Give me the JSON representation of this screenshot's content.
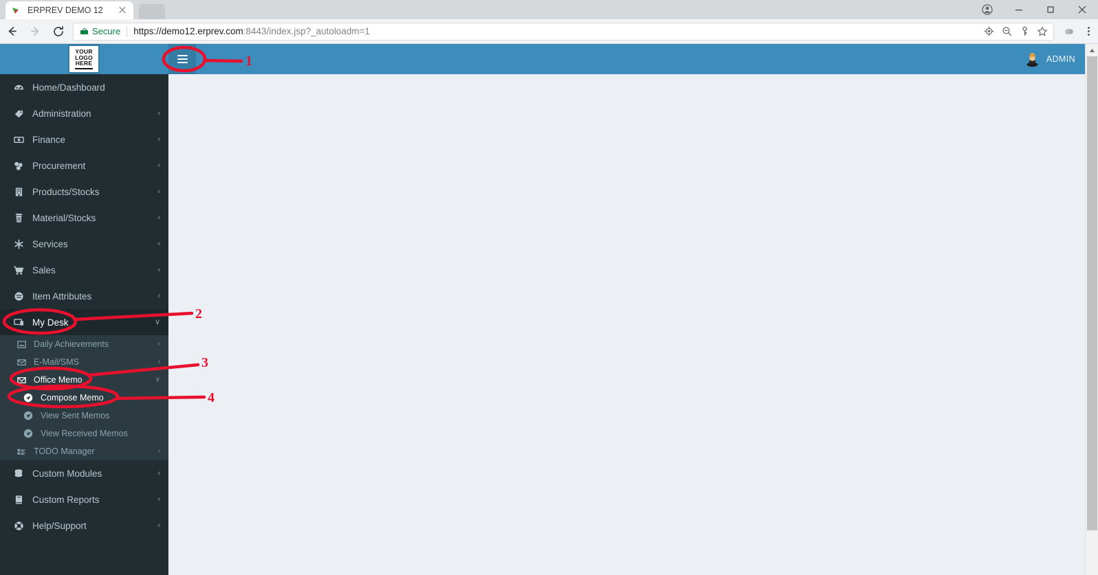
{
  "browser": {
    "tab": {
      "title": "ERPREV DEMO 12",
      "favicon": "erprev-favicon",
      "close": "close-tab-icon"
    },
    "new_tab_ghost": "inactive-tab",
    "nav": {
      "back": "back-arrow-icon",
      "forward": "forward-arrow-icon",
      "reload": "reload-icon"
    },
    "omnibox": {
      "security_label": "Secure",
      "url_scheme_host": "https://demo12.erprev.com",
      "url_rest": ":8443/index.jsp?_autoloadm=1",
      "full_url": "https://demo12.erprev.com:8443/index.jsp?_autoloadm=1",
      "icons": [
        "location-target-icon",
        "zoom-out-icon",
        "key-icon",
        "bookmark-star-icon"
      ]
    },
    "toolbar_icons": [
      "extension-icon",
      "chrome-menu-icon"
    ],
    "window_controls": [
      "profile-icon",
      "minimize-icon",
      "maximize-icon",
      "close-icon"
    ]
  },
  "topbar": {
    "logo_line1": "YOUR",
    "logo_line2": "LOGO",
    "logo_line3": "HERE",
    "toggle": "hamburger-menu-icon",
    "user_name": "ADMIN",
    "avatar": "user-avatar-icon",
    "accent_color": "#3c8dbc",
    "accent_dark_color": "#357ca5"
  },
  "sidebar": {
    "background_color": "#222d32",
    "submenu_background_color": "#2c3b41",
    "items": [
      {
        "label": "Home/Dashboard",
        "icon": "dashboard-icon",
        "arrow": ""
      },
      {
        "label": "Administration",
        "icon": "tags-icon",
        "arrow": "‹"
      },
      {
        "label": "Finance",
        "icon": "money-icon",
        "arrow": "‹"
      },
      {
        "label": "Procurement",
        "icon": "sitemap-icon",
        "arrow": "‹"
      },
      {
        "label": "Products/Stocks",
        "icon": "building-icon",
        "arrow": "‹"
      },
      {
        "label": "Material/Stocks",
        "icon": "trash-icon",
        "arrow": "‹"
      },
      {
        "label": "Services",
        "icon": "asterisk-icon",
        "arrow": "‹"
      },
      {
        "label": "Sales",
        "icon": "shopping-cart-icon",
        "arrow": "‹"
      },
      {
        "label": "Item Attributes",
        "icon": "circle-disc-icon",
        "arrow": "‹"
      }
    ],
    "my_desk": {
      "label": "My Desk",
      "icon": "desk-icon",
      "arrow": "∨",
      "state": "expanded"
    },
    "my_desk_children": [
      {
        "label": "Daily Achievements",
        "icon": "picture-icon",
        "arrow": "‹"
      },
      {
        "label": "E-Mail/SMS",
        "icon": "envelope-icon",
        "arrow": "‹"
      },
      {
        "label": "Office Memo",
        "icon": "open-envelope-icon",
        "arrow": "∨",
        "state": "expanded"
      }
    ],
    "office_memo_children": [
      {
        "label": "Compose Memo",
        "icon": "paper-plane-icon",
        "active": true
      },
      {
        "label": "View Sent Memos",
        "icon": "paper-plane-icon",
        "active": false
      },
      {
        "label": "View Received Memos",
        "icon": "paper-plane-icon",
        "active": false
      }
    ],
    "todo": {
      "label": "TODO Manager",
      "icon": "list-icon",
      "arrow": "‹"
    },
    "bottom_items": [
      {
        "label": "Custom Modules",
        "icon": "database-icon",
        "arrow": "‹"
      },
      {
        "label": "Custom Reports",
        "icon": "book-icon",
        "arrow": "‹"
      },
      {
        "label": "Help/Support",
        "icon": "lifebuoy-icon",
        "arrow": "‹"
      }
    ]
  },
  "annotations": {
    "color": "#e8112d",
    "markers": [
      {
        "number": "1",
        "target": "hamburger-menu-icon"
      },
      {
        "number": "2",
        "target": "My Desk"
      },
      {
        "number": "3",
        "target": "Office Memo"
      },
      {
        "number": "4",
        "target": "Compose Memo"
      }
    ]
  },
  "scrollbar": {
    "name": "page-scrollbar",
    "arrow": "scroll-up-arrow-icon"
  }
}
